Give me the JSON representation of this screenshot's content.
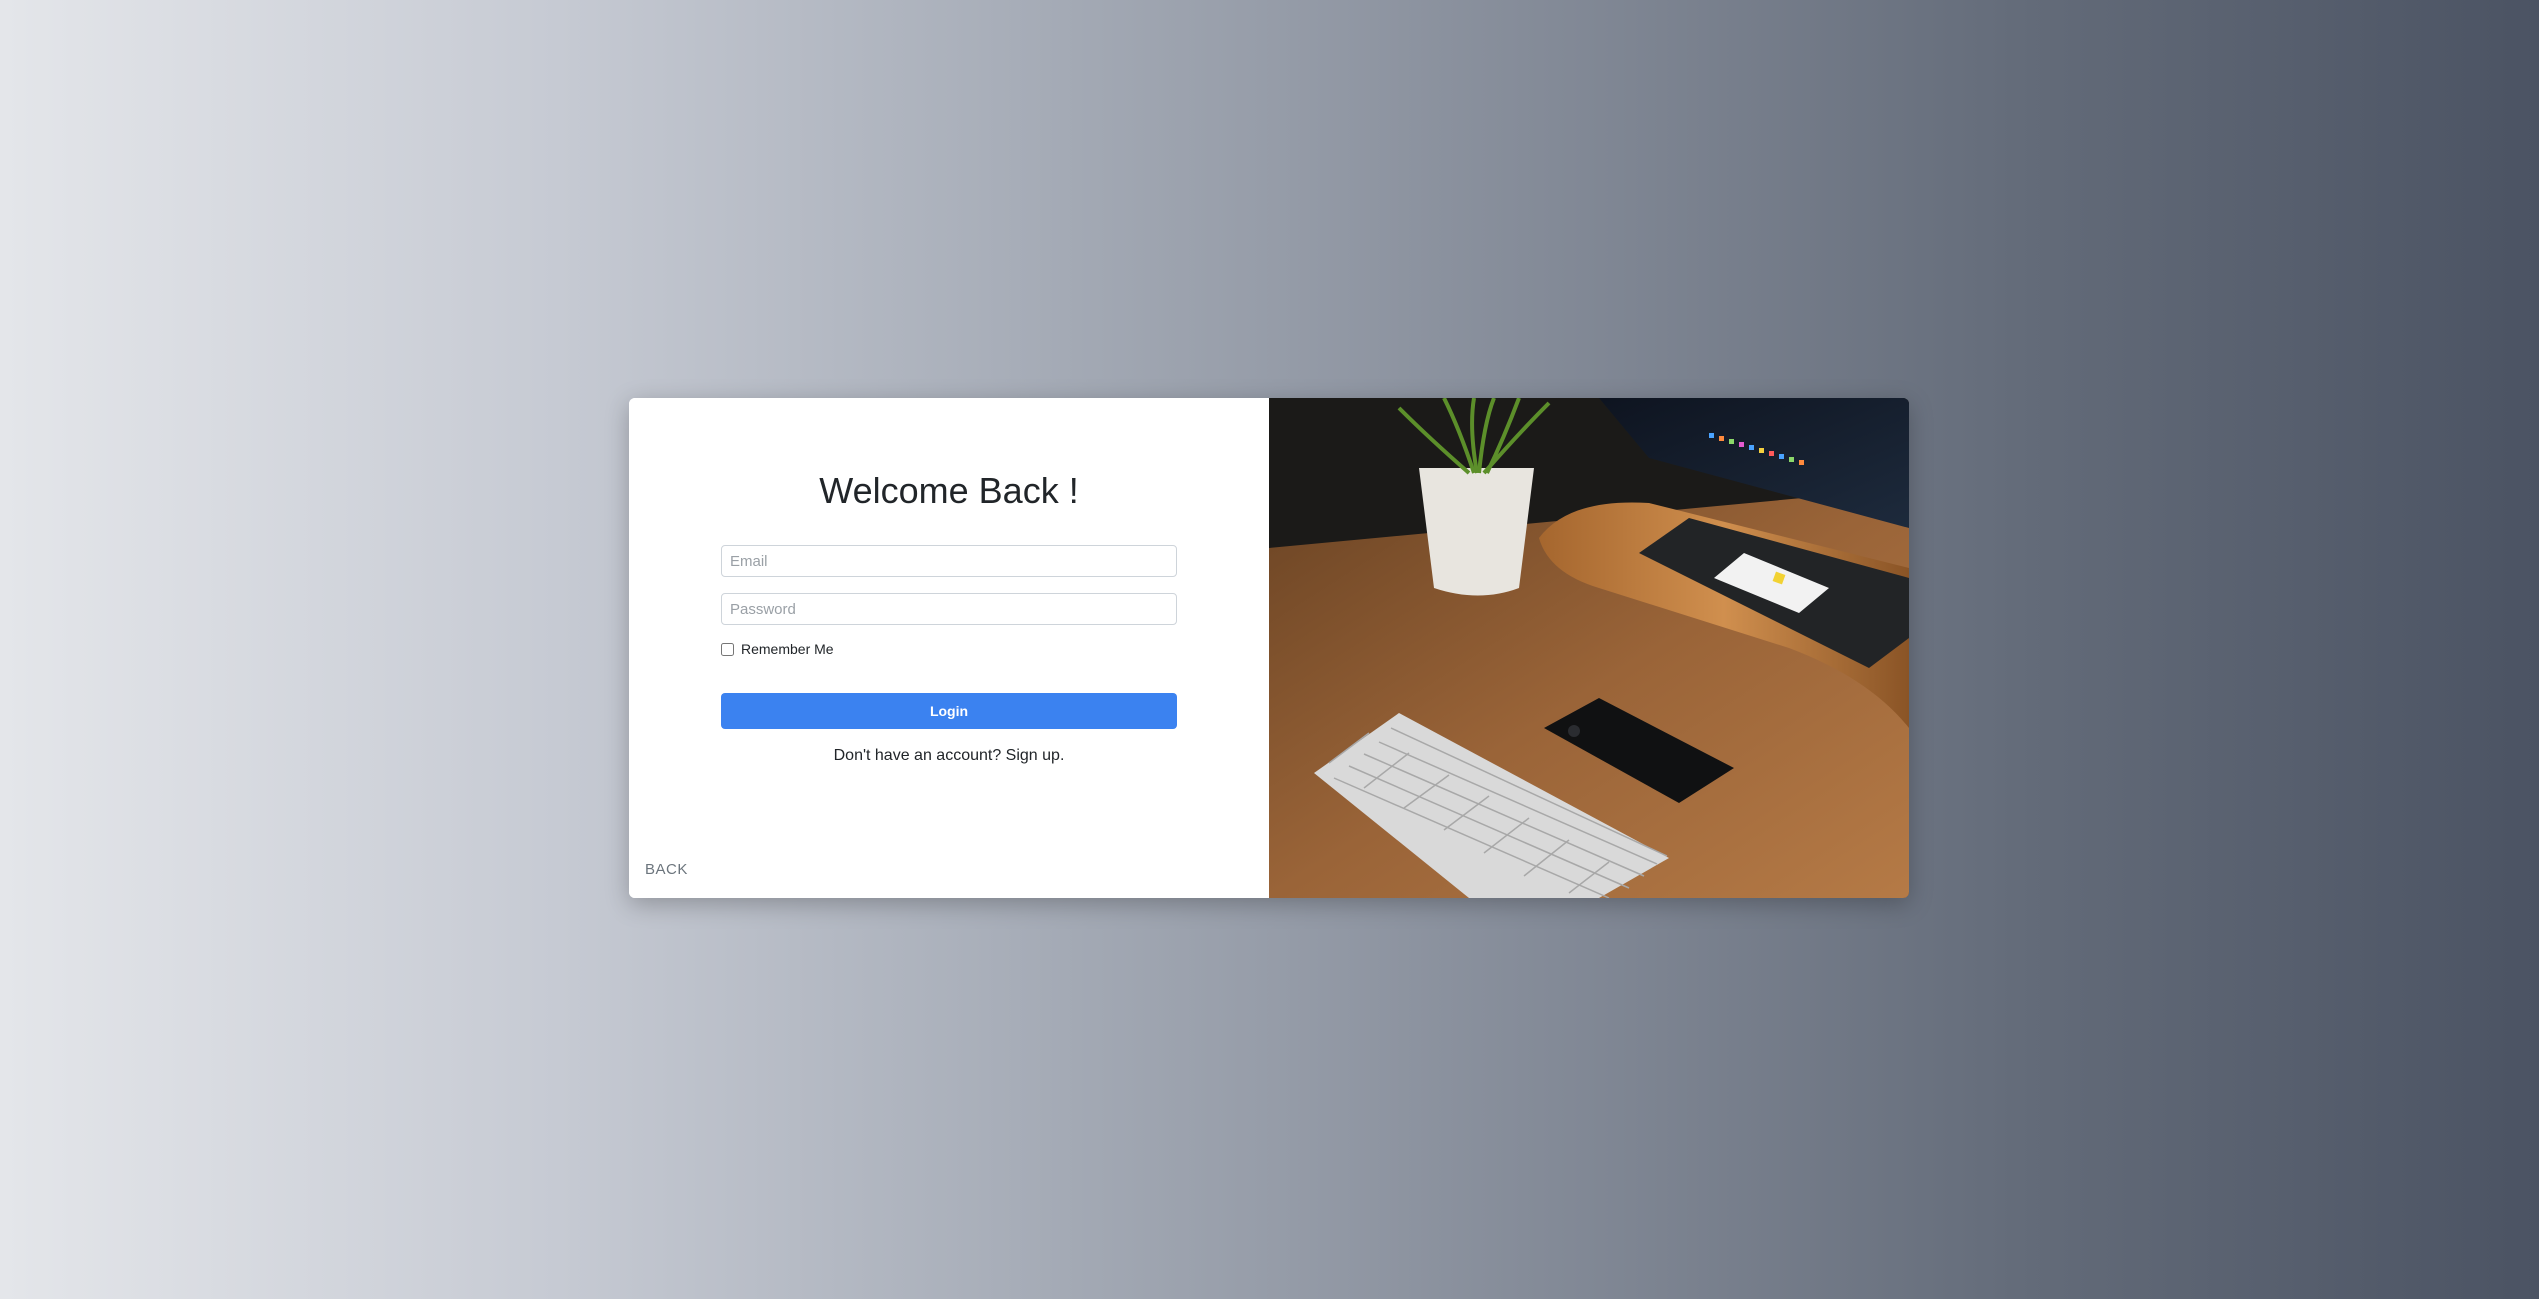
{
  "login": {
    "title": "Welcome Back !",
    "email_placeholder": "Email",
    "password_placeholder": "Password",
    "remember_label": "Remember Me",
    "login_button": "Login",
    "signup_prefix": "Don't have an account? ",
    "signup_link": "Sign up.",
    "back_link": "BACK"
  },
  "colors": {
    "primary_button": "#3b82f0",
    "card_background": "#ffffff",
    "page_gradient_start": "#e4e6ea",
    "page_gradient_end": "#4b5363"
  },
  "image": {
    "subject": "desk-workspace-photo"
  }
}
